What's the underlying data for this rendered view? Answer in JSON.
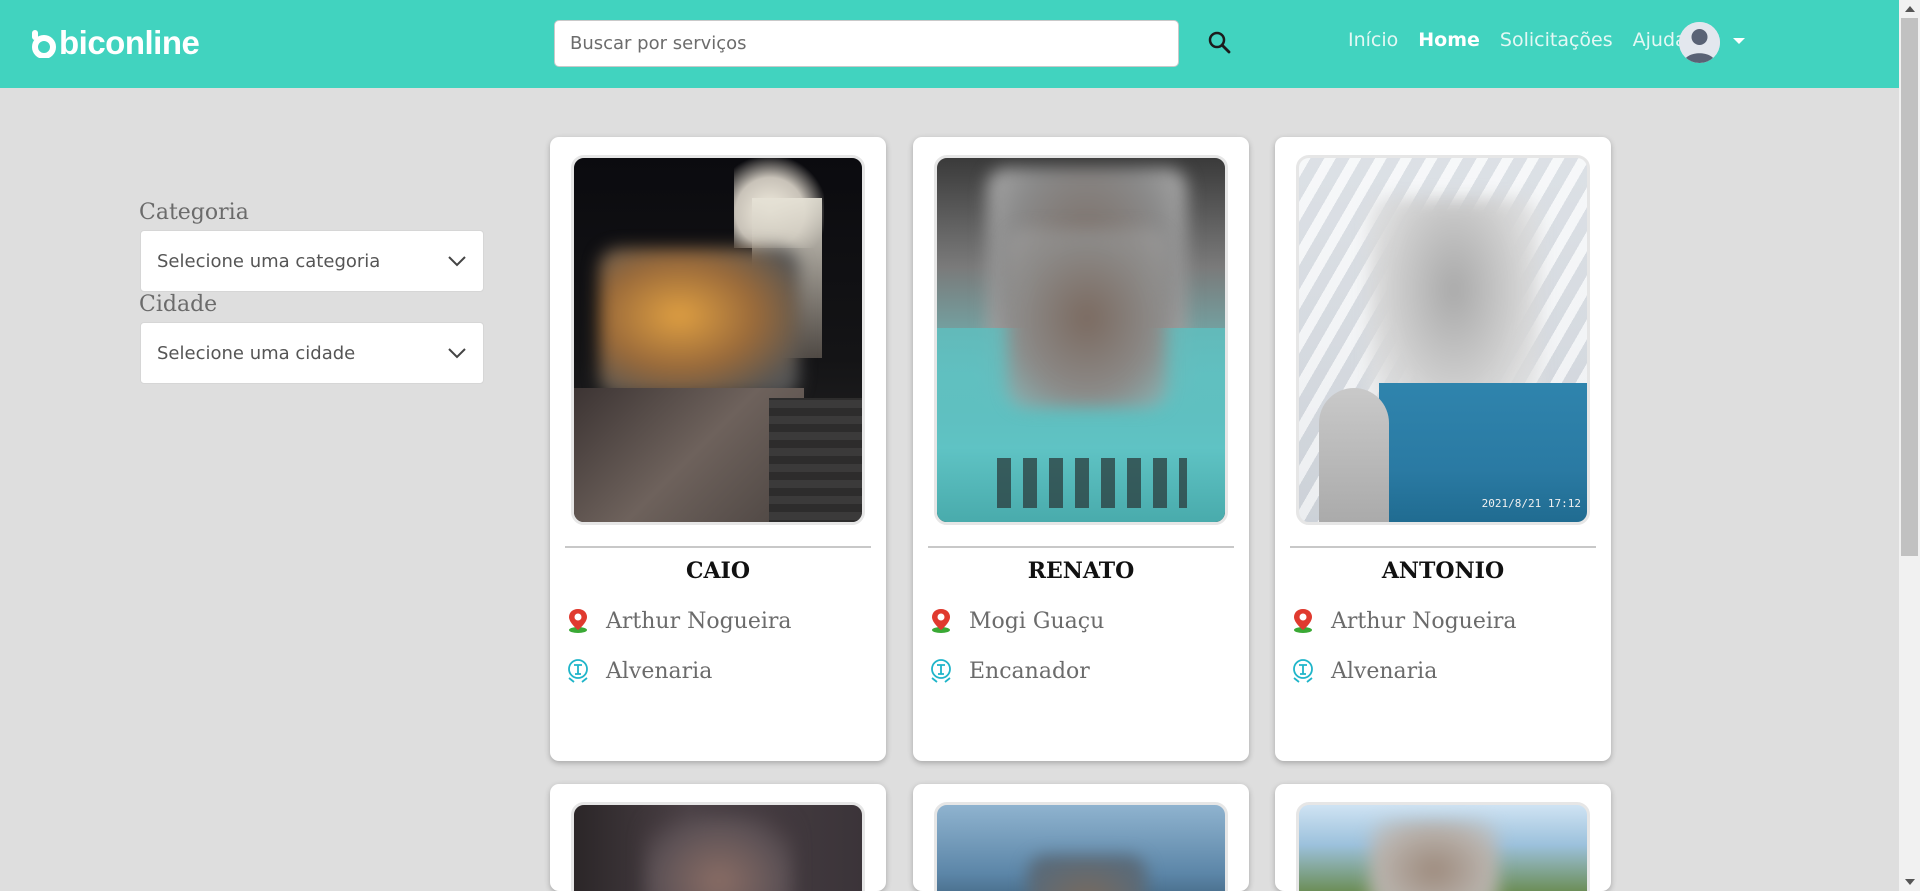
{
  "brand": {
    "name": "biconline"
  },
  "search": {
    "placeholder": "Buscar por serviços",
    "value": ""
  },
  "nav": {
    "links": [
      {
        "label": "Início",
        "active": false
      },
      {
        "label": "Home",
        "active": true
      },
      {
        "label": "Solicitações",
        "active": false
      },
      {
        "label": "Ajuda",
        "active": false
      }
    ]
  },
  "filters": {
    "category_label": "Categoria",
    "category_value": "Selecione uma categoria",
    "city_label": "Cidade",
    "city_value": "Selecione uma cidade"
  },
  "cards": [
    {
      "name": "CAIO",
      "city": "Arthur Nogueira",
      "category": "Alvenaria"
    },
    {
      "name": "RENATO",
      "city": "Mogi Guaçu",
      "category": "Encanador"
    },
    {
      "name": "ANTONIO",
      "city": "Arthur Nogueira",
      "category": "Alvenaria",
      "photo_stamp": "2021/8/21 17:12"
    }
  ],
  "icons": {
    "search": "search-icon",
    "location": "location-pin-icon",
    "category": "toolbox-icon",
    "chevron": "chevron-down-icon",
    "user": "user-avatar-icon",
    "caret": "caret-down-icon"
  },
  "colors": {
    "navbar": "#41d3bf",
    "background": "#dedede",
    "pin_red": "#e03a2f",
    "pin_green": "#3aa935",
    "category_icon": "#1fb5c9"
  }
}
